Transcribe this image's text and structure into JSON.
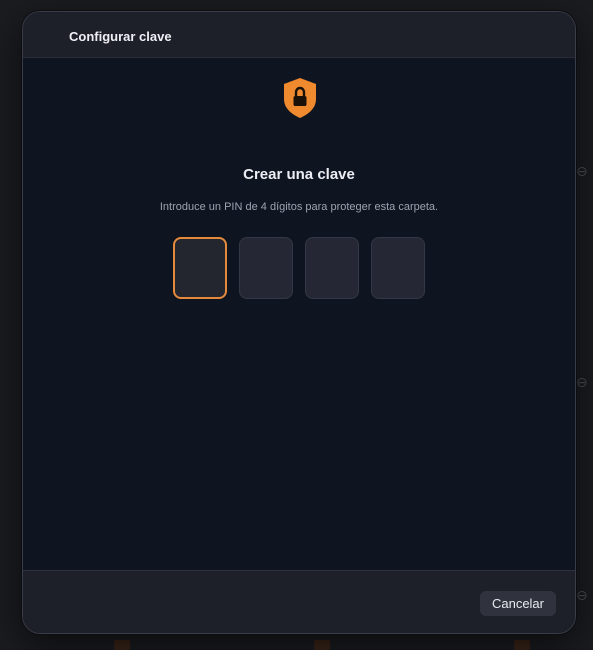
{
  "dialog": {
    "title": "Configurar clave",
    "icon": "shield-lock-icon",
    "accent_color": "#e58a3a",
    "heading": "Crear una clave",
    "description": "Introduce un PIN de 4 dígitos para proteger esta carpeta.",
    "pin": {
      "length": 4,
      "digits": [
        "",
        "",
        "",
        ""
      ],
      "active_index": 0
    },
    "footer": {
      "cancel_label": "Cancelar"
    }
  }
}
